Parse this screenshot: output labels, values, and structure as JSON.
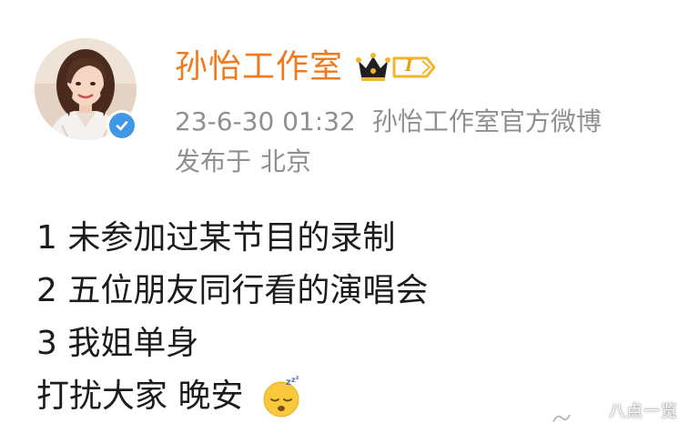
{
  "post": {
    "author": {
      "name": "孙怡工作室",
      "avatar_icon": "profile-photo",
      "verified_icon": "verified-check-icon",
      "vip_icon": "crown-icon",
      "level_badge": "I",
      "accent_color": "#f07a1e",
      "verified_color": "#3f97e6"
    },
    "meta": {
      "timestamp": "23-6-30 01:32",
      "source": "孙怡工作室官方微博",
      "published_label": "发布于",
      "location": "北京"
    },
    "content": {
      "lines": [
        "1 未参加过某节目的录制",
        "2 五位朋友同行看的演唱会",
        "3 我姐单身",
        "打扰大家 晚安"
      ],
      "emoji": "sleeping-face-emoji"
    }
  },
  "watermark": {
    "text": "八点一览"
  }
}
